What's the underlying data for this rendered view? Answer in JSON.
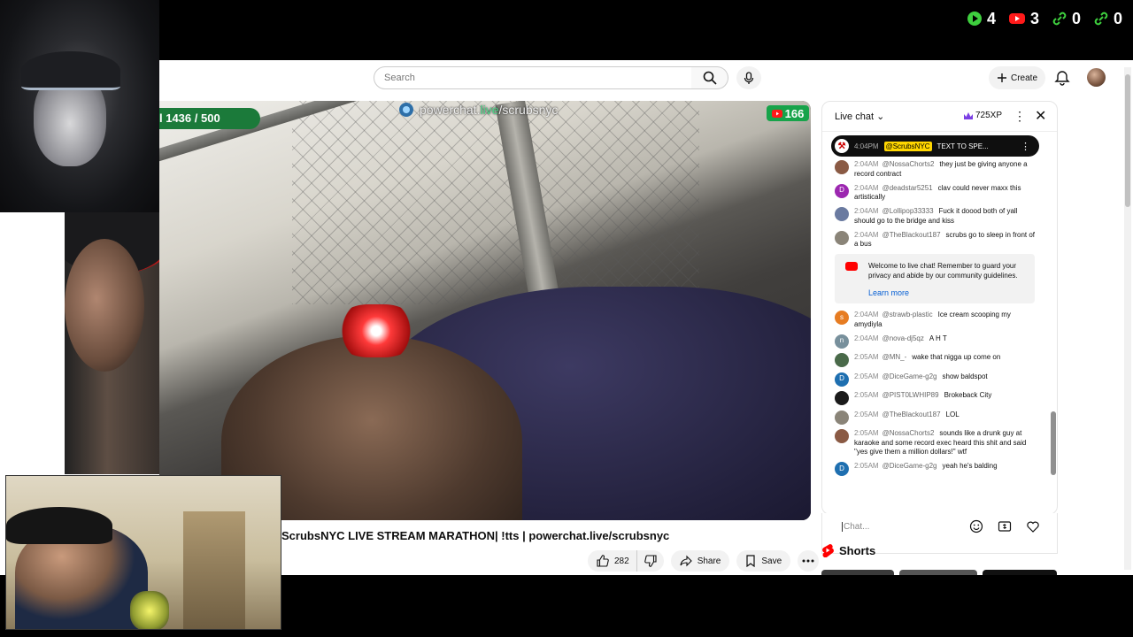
{
  "overlay_stats": [
    {
      "icon": "play-icon",
      "value": "4",
      "color": "#3ecf3e"
    },
    {
      "icon": "youtube-icon",
      "value": "3",
      "color": "#ff1a1a"
    },
    {
      "icon": "link-icon",
      "value": "0",
      "color": "#3ecf3e"
    },
    {
      "icon": "link-icon",
      "value": "0",
      "color": "#3ecf3e"
    }
  ],
  "header": {
    "search_placeholder": "Search",
    "create_label": "Create"
  },
  "player": {
    "goal_text": "l 1436 / 500",
    "watermark_prefix": "powerchat.",
    "watermark_live": "live",
    "watermark_suffix": "/scrubsnyc",
    "viewer_count": "166"
  },
  "video": {
    "title": "ScrubsNYC LIVE STREAM MARATHON| !tts | powerchat.live/scrubsnyc",
    "like_count": "282",
    "share_label": "Share",
    "save_label": "Save"
  },
  "chat": {
    "header_label": "Live chat",
    "xp_label": "725XP",
    "pinned": {
      "time": "4:04PM",
      "author": "@ScrubsNYC",
      "text": "TEXT TO SPE..."
    },
    "messages_before": [
      {
        "initial": "",
        "color": "#8a5a44",
        "time": "2:04AM",
        "author": "@NossaChorts2",
        "text": "they just be giving anyone a record contract"
      },
      {
        "initial": "D",
        "color": "#9c27b0",
        "time": "2:04AM",
        "author": "@deadstar5251",
        "text": "clav could never maxx this artistically"
      },
      {
        "initial": "",
        "color": "#6a7aa0",
        "time": "2:04AM",
        "author": "@Lollipop33333",
        "text": "Fuck it doood both of yall should go to the bridge and kiss"
      },
      {
        "initial": "",
        "color": "#8a8478",
        "time": "2:04AM",
        "author": "@TheBlackout187",
        "text": "scrubs go to sleep in front of a bus"
      }
    ],
    "welcome_text": "Welcome to live chat! Remember to guard your privacy and abide by our community guidelines.",
    "learn_more": "Learn more",
    "messages_after": [
      {
        "initial": "s",
        "color": "#e67c22",
        "time": "2:04AM",
        "author": "@strawb-plastic",
        "text": "Ice cream scooping my amydiyla"
      },
      {
        "initial": "n",
        "color": "#78909c",
        "time": "2:04AM",
        "author": "@nova-dj5qz",
        "text": "A H T"
      },
      {
        "initial": "",
        "color": "#4a6a4a",
        "time": "2:05AM",
        "author": "@MN_-",
        "text": "wake that nigga up come on"
      },
      {
        "initial": "D",
        "color": "#1e6fb0",
        "time": "2:05AM",
        "author": "@DiceGame-g2g",
        "text": "show baldspot"
      },
      {
        "initial": "",
        "color": "#1a1a1a",
        "time": "2:05AM",
        "author": "@PIST0LWHIP89",
        "text": "Brokeback City"
      },
      {
        "initial": "",
        "color": "#8a8478",
        "time": "2:05AM",
        "author": "@TheBlackout187",
        "text": "LOL"
      },
      {
        "initial": "",
        "color": "#8a5a44",
        "time": "2:05AM",
        "author": "@NossaChorts2",
        "text": "sounds like a drunk guy at karaoke and some record exec heard this shit and said \"yes give them a million dollars!\" wtf"
      },
      {
        "initial": "D",
        "color": "#1e6fb0",
        "time": "2:05AM",
        "author": "@DiceGame-g2g",
        "text": "yeah he's balding"
      }
    ],
    "input_placeholder": "Chat..."
  },
  "shorts": {
    "label": "Shorts"
  }
}
